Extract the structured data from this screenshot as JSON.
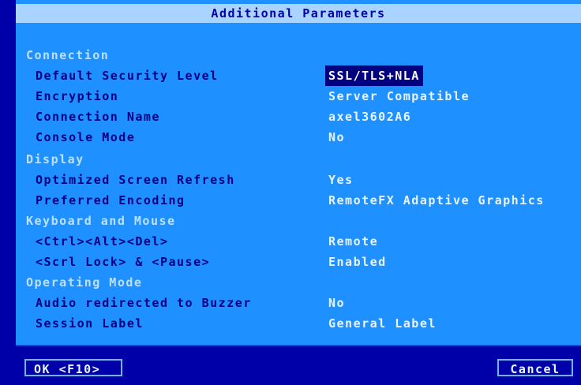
{
  "title": "Additional Parameters",
  "sections": [
    {
      "name": "Connection",
      "items": [
        {
          "label": "Default Security Level",
          "value": "SSL/TLS+NLA",
          "selected": true
        },
        {
          "label": "Encryption",
          "value": "Server Compatible"
        },
        {
          "label": "Connection Name",
          "value": "axel3602A6"
        },
        {
          "label": "Console Mode",
          "value": "No"
        }
      ]
    },
    {
      "name": "Display",
      "items": [
        {
          "label": "Optimized Screen Refresh",
          "value": "Yes"
        },
        {
          "label": "Preferred Encoding",
          "value": "RemoteFX Adaptive Graphics"
        }
      ]
    },
    {
      "name": "Keyboard and Mouse",
      "items": [
        {
          "label": "<Ctrl><Alt><Del>",
          "value": "Remote"
        },
        {
          "label": "<Scrl Lock> & <Pause>",
          "value": "Enabled"
        }
      ]
    },
    {
      "name": "Operating Mode",
      "items": [
        {
          "label": "Audio redirected to Buzzer",
          "value": "No"
        },
        {
          "label": "Session Label",
          "value": "General Label"
        }
      ]
    }
  ],
  "buttons": {
    "ok": "OK <F10>",
    "cancel": "Cancel"
  }
}
